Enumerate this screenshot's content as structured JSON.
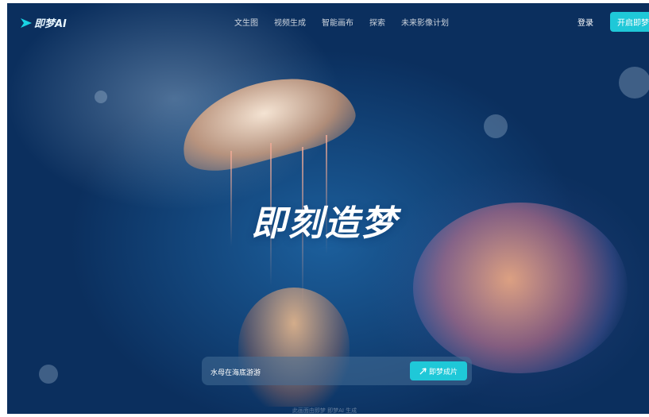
{
  "brand": {
    "name": "即梦AI"
  },
  "nav": {
    "items": [
      "文生图",
      "视频生成",
      "智能画布",
      "探索",
      "未来影像计划"
    ],
    "login": "登录",
    "start": "开启即梦"
  },
  "hero": {
    "title": "即刻造梦"
  },
  "prompt": {
    "value": "水母在海底游游",
    "button": "即梦成片"
  },
  "caption": "此画面由即梦 即梦AI 生成",
  "colors": {
    "accent": "#1fc8d8",
    "background": "#0b2f5e"
  }
}
